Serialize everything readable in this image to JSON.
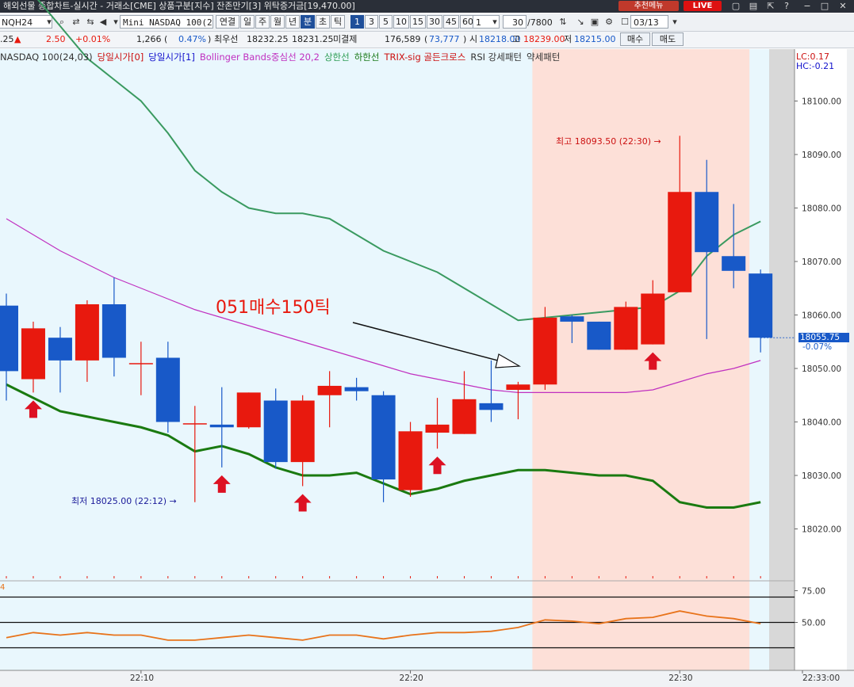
{
  "titlebar": {
    "title": "해외선물 종합차트-실시간 - 거래소[CME] 상품구분[지수] 잔존만기[3] 위탁증거금[19,470.00]",
    "recommend_label": "추천메뉴",
    "live_label": "LIVE"
  },
  "toolbar": {
    "symbol": "NQH24",
    "product": "Mini NASDAQ 100(24.0",
    "period_buttons": [
      "연결",
      "일",
      "주",
      "월",
      "년",
      "분",
      "초",
      "틱"
    ],
    "selected_period": "분",
    "interval_buttons": [
      "1",
      "3",
      "5",
      "10",
      "15",
      "30",
      "45",
      "60"
    ],
    "selected_interval": "1",
    "interval_select": "1",
    "count_value": "30",
    "count_total": "/7800",
    "date_value": "03/13"
  },
  "quote": {
    "change_prefix": ".25",
    "change_arrow": "▲",
    "change_value": "2.50",
    "change_pct": "+0.01%",
    "volume": "1,266",
    "volume_pct": "0.47%",
    "best_ask_label": "최우선",
    "best_ask": "18232.25",
    "best_bid": "18231.25",
    "open_interest_label": "미결제",
    "open_interest": "176,589",
    "open_interest_change": "73,777",
    "open_label": "시",
    "open": "18218.00",
    "high_label": "고",
    "high": "18239.00",
    "low_label": "저",
    "low": "18215.00",
    "buy_label": "매수",
    "sell_label": "매도"
  },
  "legend": {
    "items": [
      {
        "text": "NASDAQ 100(24,03)",
        "color": "#333333"
      },
      {
        "text": "당일시가[0]",
        "color": "#cc1111"
      },
      {
        "text": "당일시가[1]",
        "color": "#1111cc"
      },
      {
        "text": "Bollinger Bands중심선 20,2",
        "color": "#c030c0"
      },
      {
        "text": "상한선",
        "color": "#2e9e55"
      },
      {
        "text": "하한선",
        "color": "#1a7a1a"
      },
      {
        "text": "TRIX-sig 골든크로스",
        "color": "#cc1111"
      },
      {
        "text": "RSI 강세패턴",
        "color": "#333333"
      },
      {
        "text": "약세패턴",
        "color": "#333333"
      }
    ],
    "lc": "LC:0.17",
    "hc": "HC:-0.21"
  },
  "annotations": {
    "high_marker": "최고 18093.50 (22:30) →",
    "low_marker": "최저 18025.00 (22:12) →",
    "callout": "051매수150틱",
    "current_price": "18055.75",
    "current_pct": "-0.07%",
    "lower_left_label": "4"
  },
  "colors": {
    "up": "#e8190e",
    "down": "#1859c8",
    "bb_upper": "#3a9a60",
    "bb_lower": "#1a7a10",
    "bb_mid": "#c030c0",
    "rsi": "#e8731a",
    "bg": "#e9f7fd",
    "highlight": "#fde0d8",
    "signal_arrow": "#dd1122"
  },
  "chart_data": [
    {
      "type": "candlestick",
      "title": "NASDAQ 100(24,03)",
      "ylim": [
        18014,
        18104
      ],
      "y_ticks": [
        18020,
        18030,
        18040,
        18050,
        18060,
        18070,
        18080,
        18090,
        18100
      ],
      "y_tick_labels": [
        "18020.00",
        "18030.00",
        "18040.00",
        "18050.00",
        "18060.00",
        "18070.00",
        "18080.00",
        "18090.00",
        "18100.00"
      ],
      "x_tick_labels": [
        {
          "index": 5,
          "label": "22:10"
        },
        {
          "index": 15,
          "label": "22:20"
        },
        {
          "index": 25,
          "label": "22:30"
        },
        {
          "index": 30,
          "label": "22:33:00"
        }
      ],
      "candles": [
        {
          "o": 18061.75,
          "h": 18064.0,
          "c": 18049.5,
          "l": 18044.0
        },
        {
          "o": 18048.0,
          "h": 18058.75,
          "c": 18057.5,
          "l": 18045.5
        },
        {
          "o": 18055.75,
          "h": 18057.75,
          "c": 18051.5,
          "l": 18045.5
        },
        {
          "o": 18051.5,
          "h": 18062.75,
          "c": 18062.0,
          "l": 18047.5
        },
        {
          "o": 18062.0,
          "h": 18067.0,
          "c": 18052.0,
          "l": 18048.5
        },
        {
          "o": 18051.0,
          "h": 18055.0,
          "c": 18051.0,
          "l": 18045.0
        },
        {
          "o": 18052.0,
          "h": 18055.0,
          "c": 18040.0,
          "l": 18038.0
        },
        {
          "o": 18039.75,
          "h": 18043.0,
          "c": 18039.75,
          "l": 18025.0
        },
        {
          "o": 18039.5,
          "h": 18046.5,
          "c": 18039.0,
          "l": 18031.5
        },
        {
          "o": 18039.0,
          "h": 18045.5,
          "c": 18045.5,
          "l": 18038.75
        },
        {
          "o": 18044.0,
          "h": 18046.25,
          "c": 18032.5,
          "l": 18031.25
        },
        {
          "o": 18032.5,
          "h": 18045.0,
          "c": 18044.0,
          "l": 18028.0
        },
        {
          "o": 18045.0,
          "h": 18049.5,
          "c": 18046.75,
          "l": 18039.0
        },
        {
          "o": 18046.5,
          "h": 18048.25,
          "c": 18045.75,
          "l": 18044.0
        },
        {
          "o": 18045.0,
          "h": 18045.75,
          "c": 18029.25,
          "l": 18025.0
        },
        {
          "o": 18027.25,
          "h": 18040.0,
          "c": 18038.25,
          "l": 18026.0
        },
        {
          "o": 18038.0,
          "h": 18044.5,
          "c": 18039.5,
          "l": 18035.0
        },
        {
          "o": 18037.75,
          "h": 18049.5,
          "c": 18044.25,
          "l": 18037.75
        },
        {
          "o": 18043.5,
          "h": 18051.5,
          "c": 18042.25,
          "l": 18040.0
        },
        {
          "o": 18046.0,
          "h": 18047.5,
          "c": 18047.0,
          "l": 18040.5
        },
        {
          "o": 18047.0,
          "h": 18061.5,
          "c": 18059.5,
          "l": 18046.0
        },
        {
          "o": 18059.75,
          "h": 18060.0,
          "c": 18058.75,
          "l": 18054.75
        },
        {
          "o": 18058.75,
          "h": 18058.75,
          "c": 18053.5,
          "l": 18053.5
        },
        {
          "o": 18053.5,
          "h": 18062.5,
          "c": 18061.5,
          "l": 18053.5
        },
        {
          "o": 18054.5,
          "h": 18066.5,
          "c": 18064.0,
          "l": 18054.5
        },
        {
          "o": 18064.25,
          "h": 18093.5,
          "c": 18083.0,
          "l": 18064.25
        },
        {
          "o": 18083.0,
          "h": 18089.0,
          "c": 18071.75,
          "l": 18055.5
        },
        {
          "o": 18071.0,
          "h": 18080.75,
          "c": 18068.25,
          "l": 18065.0
        },
        {
          "o": 18067.75,
          "h": 18068.5,
          "c": 18055.75,
          "l": 18053.0
        }
      ],
      "series": [
        {
          "name": "상한선",
          "values": [
            18125.0,
            18120.0,
            18114.0,
            18108.0,
            18104.0,
            18100.0,
            18094.0,
            18087.0,
            18083.0,
            18080.0,
            18079.0,
            18079.0,
            18078.0,
            18075.0,
            18072.0,
            18070.0,
            18068.0,
            18065.0,
            18062.0,
            18059.0,
            18059.5,
            18060.0,
            18060.5,
            18061.0,
            18061.5,
            18064.5,
            18071.0,
            18075.0,
            18077.5
          ]
        },
        {
          "name": "하한선",
          "values": [
            18047.0,
            18044.5,
            18042.0,
            18041.0,
            18040.0,
            18039.0,
            18037.5,
            18034.5,
            18035.5,
            18034.0,
            18031.5,
            18030.0,
            18030.0,
            18030.5,
            18028.5,
            18026.5,
            18027.5,
            18029.0,
            18030.0,
            18031.0,
            18031.0,
            18030.5,
            18030.0,
            18030.0,
            18029.0,
            18025.0,
            18024.0,
            18024.0,
            18025.0
          ]
        },
        {
          "name": "Bollinger Bands중심선 20,2",
          "values": [
            18078.0,
            18075.0,
            18072.0,
            18069.5,
            18067.0,
            18065.0,
            18063.0,
            18061.0,
            18059.5,
            18058.0,
            18056.5,
            18055.0,
            18053.5,
            18052.0,
            18050.5,
            18049.0,
            18048.0,
            18047.0,
            18046.0,
            18045.5,
            18045.5,
            18045.5,
            18045.5,
            18045.5,
            18046.0,
            18047.5,
            18049.0,
            18050.0,
            18051.5
          ]
        }
      ],
      "buy_signal_indices": [
        1,
        8,
        11,
        16,
        24
      ],
      "highlight_range": [
        20,
        28
      ],
      "high_annotation": {
        "index": 25,
        "value": 18093.5
      },
      "low_annotation": {
        "index": 7,
        "value": 18025.0
      },
      "current_price": 18055.75
    },
    {
      "type": "line",
      "title": "RSI",
      "ylim": [
        22,
        86
      ],
      "y_ticks": [
        50,
        75
      ],
      "y_tick_labels": [
        "50.00",
        "75.00"
      ],
      "reference_lines": [
        30,
        50,
        70
      ],
      "series": [
        {
          "name": "RSI",
          "values": [
            38,
            42,
            40,
            42,
            40,
            40,
            36,
            36,
            38,
            40,
            38,
            36,
            40,
            40,
            37,
            40,
            42,
            42,
            43,
            46,
            52,
            51,
            49,
            53,
            54,
            59,
            55,
            53,
            49
          ]
        }
      ]
    }
  ]
}
